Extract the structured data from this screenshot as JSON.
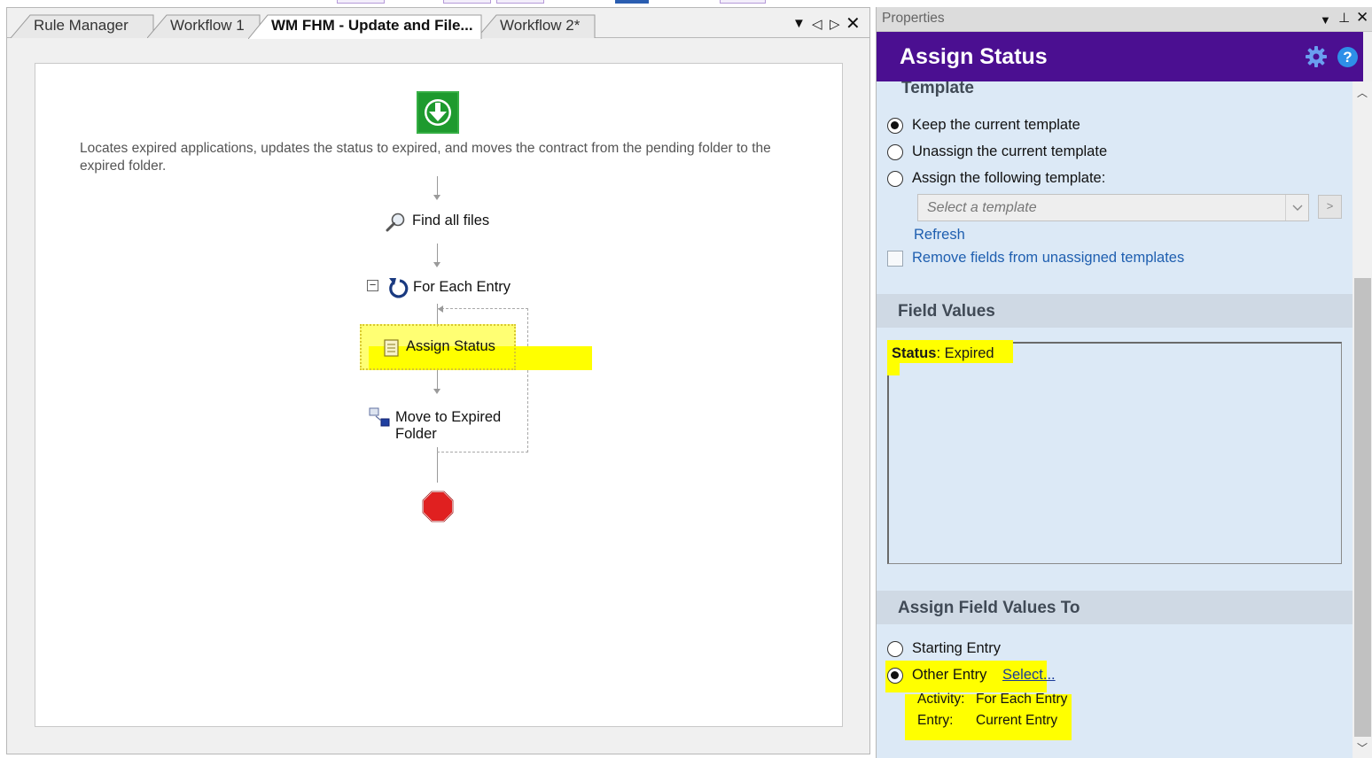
{
  "tabs": [
    {
      "label": "Rule Manager"
    },
    {
      "label": "Workflow 1"
    },
    {
      "label": "WM FHM - Update and File..."
    },
    {
      "label": "Workflow 2*"
    }
  ],
  "workflow": {
    "description": "Locates expired applications, updates the status to expired, and moves the contract from the pending folder to the expired folder.",
    "steps": {
      "find": "Find all files",
      "foreach": "For Each Entry",
      "assign": "Assign Status",
      "move_line1": "Move to Expired",
      "move_line2": "Folder"
    }
  },
  "properties": {
    "header": "Properties",
    "title": "Assign Status",
    "template_section": "Template",
    "template_options": [
      "Keep the current template",
      "Unassign the current template",
      "Assign the following template:"
    ],
    "template_selected": 0,
    "template_placeholder": "Select a template",
    "more_button": ">",
    "refresh": "Refresh",
    "remove_fields": "Remove fields from unassigned templates",
    "field_values_section": "Field Values",
    "field_name": "Status",
    "field_sep": ":",
    "field_value": "Expired",
    "assign_to_section": "Assign Field Values To",
    "assign_options": [
      "Starting Entry",
      "Other Entry"
    ],
    "assign_selected": 1,
    "select_link": "Select...",
    "activity_label": "Activity:",
    "activity_value": "For Each Entry",
    "entry_label": "Entry:",
    "entry_value": "Current Entry"
  },
  "colors": {
    "accent": "#4b0f91",
    "highlight": "#ffff00",
    "link": "#1f5fb0",
    "start": "#1e9a2e",
    "stop": "#e02020"
  }
}
